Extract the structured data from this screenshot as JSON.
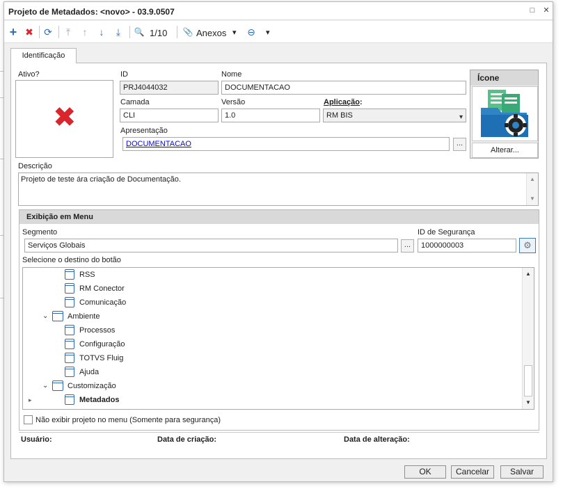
{
  "window": {
    "title": "Projeto de Metadados: <novo> - 03.9.0507",
    "minimize_glyph": "□",
    "close_glyph": "✕"
  },
  "toolbar": {
    "add_icon": "+",
    "delete_icon": "✖",
    "refresh_icon": "⟳",
    "first_icon": "⤒",
    "prev_icon": "↑",
    "next_icon": "↓",
    "last_icon": "⤓",
    "search_icon": "🔍",
    "record_counter": "1/10",
    "attachments_label": "Anexos",
    "attachments_icon": "📎",
    "dropdown_glyph": "▾",
    "more_icon": "⊖"
  },
  "tabs": [
    {
      "label": "Identificação"
    }
  ],
  "identificacao": {
    "ativo_label": "Ativo?",
    "ativo_glyph": "✖",
    "id_label": "ID",
    "id_value": "PRJ4044032",
    "nome_label": "Nome",
    "nome_value": "DOCUMENTACAO",
    "camada_label": "Camada",
    "camada_value": "CLI",
    "versao_label": "Versão",
    "versao_value": "1.0",
    "aplicacao_label": "Aplicação",
    "aplicacao_colon": ":",
    "aplicacao_value": "RM BIS",
    "apresentacao_label": "Apresentação",
    "apresentacao_value": "DOCUMENTACAO",
    "ellipsis": "...",
    "icone_header": "Ícone",
    "alterar_label": "Alterar...",
    "descricao_label": "Descrição",
    "descricao_value": "Projeto de teste ára criação de Documentação."
  },
  "menu": {
    "header": "Exibição em Menu",
    "segmento_label": "Segmento",
    "segmento_value": "Serviços Globais",
    "seguranca_label": "ID de Segurança",
    "seguranca_value": "1000000003",
    "destino_label": "Selecione o destino do botão",
    "tree": [
      {
        "label": "RSS"
      },
      {
        "label": "RM Conector"
      },
      {
        "label": "Comunicação"
      },
      {
        "label": "Ambiente"
      },
      {
        "label": "Processos"
      },
      {
        "label": "Configuração"
      },
      {
        "label": "TOTVS Fluig"
      },
      {
        "label": "Ajuda"
      },
      {
        "label": "Customização"
      },
      {
        "label": "Metadados"
      }
    ],
    "nao_exibir_label": "Não exibir projeto no menu (Somente para segurança)"
  },
  "footer": {
    "usuario_label": "Usuário:",
    "criacao_label": "Data de criação:",
    "alteracao_label": "Data de alteração:"
  },
  "buttons": {
    "ok": "OK",
    "cancelar": "Cancelar",
    "salvar": "Salvar"
  },
  "colors": {
    "accent_blue": "#2b69b9",
    "delete_red": "#d9262c",
    "link": "#0a0ad4"
  }
}
